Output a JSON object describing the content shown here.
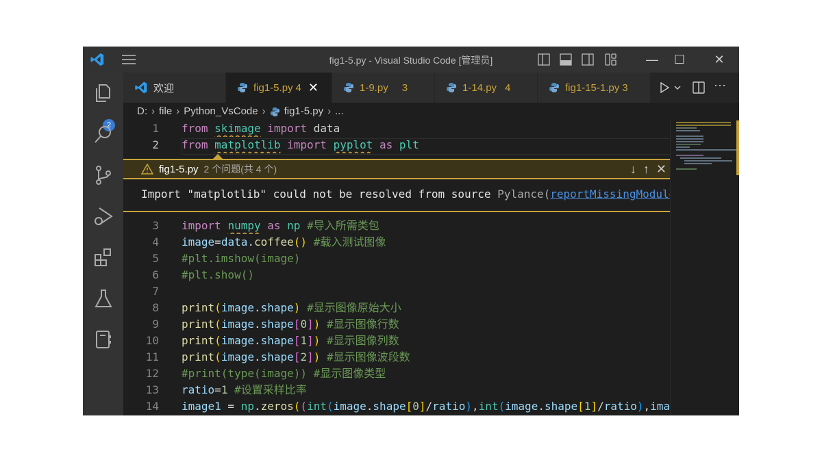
{
  "window": {
    "title": "fig1-5.py - Visual Studio Code [管理员]"
  },
  "activity": {
    "explorer_badge": "2",
    "items": [
      "explorer",
      "search",
      "source-control",
      "run-debug",
      "extensions",
      "testing",
      "notebook"
    ]
  },
  "tabs": [
    {
      "label": "欢迎",
      "count": "",
      "icon": "vscode-icon"
    },
    {
      "label": "fig1-5.py",
      "count": "4",
      "active": true,
      "icon": "python-icon"
    },
    {
      "label": "1-9.py",
      "count": "3",
      "icon": "python-icon"
    },
    {
      "label": "1-14.py",
      "count": "4",
      "icon": "python-icon"
    },
    {
      "label": "fig1-15-1.py",
      "count": "3",
      "icon": "python-icon"
    }
  ],
  "breadcrumb": [
    "D:",
    "file",
    "Python_VsCode",
    "fig1-5.py",
    "..."
  ],
  "peek": {
    "file": "fig1-5.py",
    "summary": "2 个问题(共 4 个)",
    "message": "Import \"matplotlib\" could not be resolved from source ",
    "source": "Pylance(",
    "rule": "reportMissingModuleSource"
  },
  "colors": {
    "warning": "#c9a33a",
    "accent": "#3a7bd5",
    "editor_bg": "#1e1e1e"
  },
  "code_top": [
    {
      "n": "1",
      "t": [
        [
          "from",
          "k"
        ],
        [
          " ",
          "p"
        ],
        [
          "skimage",
          "m sq"
        ],
        [
          " ",
          "p"
        ],
        [
          "import",
          "k"
        ],
        [
          " data",
          "p"
        ]
      ]
    },
    {
      "n": "2",
      "t": [
        [
          "from",
          "k"
        ],
        [
          " ",
          "p"
        ],
        [
          "matplotlib",
          "m sq"
        ],
        [
          " ",
          "p"
        ],
        [
          "import",
          "k"
        ],
        [
          " ",
          "p"
        ],
        [
          "pyplot",
          "m sq"
        ],
        [
          " ",
          "p"
        ],
        [
          "as",
          "k"
        ],
        [
          " ",
          "p"
        ],
        [
          "plt",
          "m"
        ]
      ]
    }
  ],
  "code_bottom": [
    {
      "n": "3",
      "t": [
        [
          "import",
          "k"
        ],
        [
          " ",
          "p"
        ],
        [
          "numpy",
          "m sq"
        ],
        [
          " ",
          "p"
        ],
        [
          "as",
          "k"
        ],
        [
          " ",
          "p"
        ],
        [
          "np",
          "m"
        ],
        [
          " ",
          "p"
        ],
        [
          "#导入所需类包",
          "c"
        ]
      ]
    },
    {
      "n": "4",
      "t": [
        [
          "image",
          "v"
        ],
        [
          "=",
          "p"
        ],
        [
          "data",
          "v"
        ],
        [
          ".",
          "p"
        ],
        [
          "coffee",
          "f"
        ],
        [
          "()",
          "b1"
        ],
        [
          " ",
          "p"
        ],
        [
          "#载入测试图像",
          "c"
        ]
      ]
    },
    {
      "n": "5",
      "t": [
        [
          "#plt.imshow(image)",
          "c"
        ]
      ]
    },
    {
      "n": "6",
      "t": [
        [
          "#plt.show()",
          "c"
        ]
      ]
    },
    {
      "n": "7",
      "t": []
    },
    {
      "n": "8",
      "t": [
        [
          "print",
          "f"
        ],
        [
          "(",
          "b1"
        ],
        [
          "image",
          "v"
        ],
        [
          ".",
          "p"
        ],
        [
          "shape",
          "v"
        ],
        [
          ")",
          "b1"
        ],
        [
          " ",
          "p"
        ],
        [
          "#显示图像原始大小",
          "c"
        ]
      ]
    },
    {
      "n": "9",
      "t": [
        [
          "print",
          "f"
        ],
        [
          "(",
          "b1"
        ],
        [
          "image",
          "v"
        ],
        [
          ".",
          "p"
        ],
        [
          "shape",
          "v"
        ],
        [
          "[",
          "b2"
        ],
        [
          "0",
          "n"
        ],
        [
          "]",
          "b2"
        ],
        [
          ")",
          "b1"
        ],
        [
          " ",
          "p"
        ],
        [
          "#显示图像行数",
          "c"
        ]
      ]
    },
    {
      "n": "10",
      "t": [
        [
          "print",
          "f"
        ],
        [
          "(",
          "b1"
        ],
        [
          "image",
          "v"
        ],
        [
          ".",
          "p"
        ],
        [
          "shape",
          "v"
        ],
        [
          "[",
          "b2"
        ],
        [
          "1",
          "n"
        ],
        [
          "]",
          "b2"
        ],
        [
          ")",
          "b1"
        ],
        [
          " ",
          "p"
        ],
        [
          "#显示图像列数",
          "c"
        ]
      ]
    },
    {
      "n": "11",
      "t": [
        [
          "print",
          "f"
        ],
        [
          "(",
          "b1"
        ],
        [
          "image",
          "v"
        ],
        [
          ".",
          "p"
        ],
        [
          "shape",
          "v"
        ],
        [
          "[",
          "b2"
        ],
        [
          "2",
          "n"
        ],
        [
          "]",
          "b2"
        ],
        [
          ")",
          "b1"
        ],
        [
          " ",
          "p"
        ],
        [
          "#显示图像波段数",
          "c"
        ]
      ]
    },
    {
      "n": "12",
      "t": [
        [
          "#print(type(image)) #显示图像类型",
          "c"
        ]
      ]
    },
    {
      "n": "13",
      "t": [
        [
          "ratio",
          "v"
        ],
        [
          "=",
          "p"
        ],
        [
          "1",
          "n"
        ],
        [
          " ",
          "p"
        ],
        [
          "#设置采样比率",
          "c"
        ]
      ]
    },
    {
      "n": "14",
      "t": [
        [
          "image1",
          "v"
        ],
        [
          " = ",
          "p"
        ],
        [
          "np",
          "m"
        ],
        [
          ".",
          "p"
        ],
        [
          "zeros",
          "f"
        ],
        [
          "(",
          "b1"
        ],
        [
          "(",
          "b2"
        ],
        [
          "int",
          "m"
        ],
        [
          "(",
          "b3"
        ],
        [
          "image",
          "v"
        ],
        [
          ".",
          "p"
        ],
        [
          "shape",
          "v"
        ],
        [
          "[",
          "b1"
        ],
        [
          "0",
          "n"
        ],
        [
          "]",
          "b1"
        ],
        [
          "/",
          "p"
        ],
        [
          "ratio",
          "v"
        ],
        [
          ")",
          "b3"
        ],
        [
          ",",
          "p"
        ],
        [
          "int",
          "m"
        ],
        [
          "(",
          "b3"
        ],
        [
          "image",
          "v"
        ],
        [
          ".",
          "p"
        ],
        [
          "shape",
          "v"
        ],
        [
          "[",
          "b1"
        ],
        [
          "1",
          "n"
        ],
        [
          "]",
          "b1"
        ],
        [
          "/",
          "p"
        ],
        [
          "ratio",
          "v"
        ],
        [
          ")",
          "b3"
        ],
        [
          ",",
          "p"
        ],
        [
          "ima",
          "v"
        ]
      ]
    }
  ]
}
